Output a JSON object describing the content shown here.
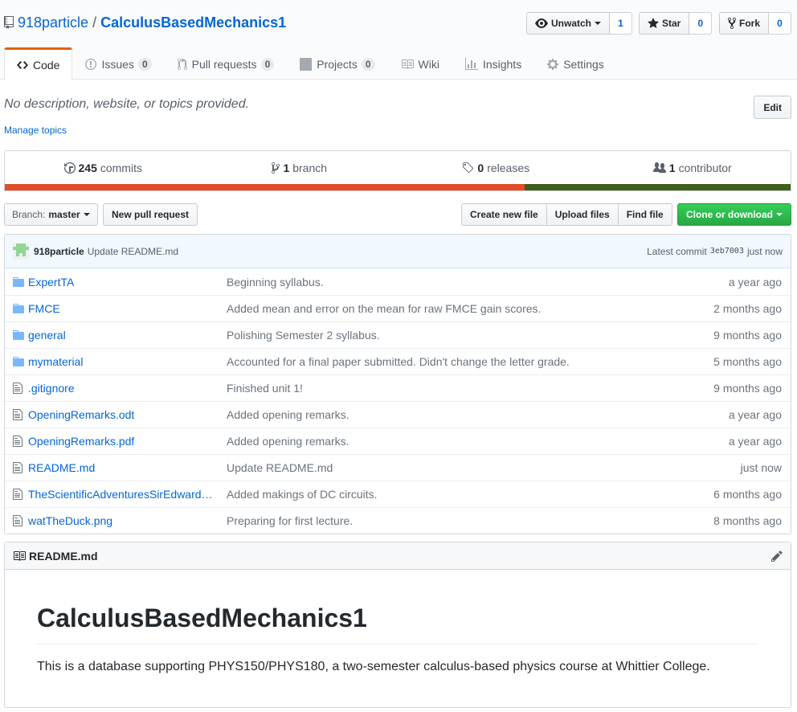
{
  "header": {
    "owner": "918particle",
    "separator": "/",
    "repo": "CalculusBasedMechanics1",
    "watch": {
      "label": "Unwatch",
      "count": "1"
    },
    "star": {
      "label": "Star",
      "count": "0"
    },
    "fork": {
      "label": "Fork",
      "count": "0"
    }
  },
  "tabs": [
    {
      "label": "Code",
      "icon": "code-icon",
      "selected": true
    },
    {
      "label": "Issues",
      "icon": "issue-icon",
      "count": "0"
    },
    {
      "label": "Pull requests",
      "icon": "pull-request-icon",
      "count": "0"
    },
    {
      "label": "Projects",
      "icon": "project-icon",
      "count": "0"
    },
    {
      "label": "Wiki",
      "icon": "book-icon"
    },
    {
      "label": "Insights",
      "icon": "graph-icon"
    },
    {
      "label": "Settings",
      "icon": "gear-icon"
    }
  ],
  "description": {
    "text": "No description, website, or topics provided.",
    "manage_topics": "Manage topics",
    "edit_label": "Edit"
  },
  "summary": {
    "commits": {
      "count": "245",
      "label": "commits"
    },
    "branches": {
      "count": "1",
      "label": "branch"
    },
    "releases": {
      "count": "0",
      "label": "releases"
    },
    "contributors": {
      "count": "1",
      "label": "contributor"
    },
    "languages": [
      {
        "color": "#e34c26",
        "percent": 66.2
      },
      {
        "color": "#3e5f1c",
        "percent": 33.8
      }
    ]
  },
  "nav": {
    "branch_label": "Branch:",
    "branch_name": "master",
    "new_pr": "New pull request",
    "create_file": "Create new file",
    "upload_files": "Upload files",
    "find_file": "Find file",
    "clone": "Clone or download"
  },
  "commit": {
    "author": "918particle",
    "message": "Update README.md",
    "latest_label": "Latest commit",
    "sha": "3eb7003",
    "time": "just now"
  },
  "files": [
    {
      "name": "ExpertTA",
      "type": "dir",
      "message": "Beginning syllabus.",
      "age": "a year ago"
    },
    {
      "name": "FMCE",
      "type": "dir",
      "message": "Added mean and error on the mean for raw FMCE gain scores.",
      "age": "2 months ago"
    },
    {
      "name": "general",
      "type": "dir",
      "message": "Polishing Semester 2 syllabus.",
      "age": "9 months ago"
    },
    {
      "name": "mymaterial",
      "type": "dir",
      "message": "Accounted for a final paper submitted. Didn't change the letter grade.",
      "age": "5 months ago"
    },
    {
      "name": ".gitignore",
      "type": "file",
      "message": "Finished unit 1!",
      "age": "9 months ago"
    },
    {
      "name": "OpeningRemarks.odt",
      "type": "file",
      "message": "Added opening remarks.",
      "age": "a year ago"
    },
    {
      "name": "OpeningRemarks.pdf",
      "type": "file",
      "message": "Added opening remarks.",
      "age": "a year ago"
    },
    {
      "name": "README.md",
      "type": "file",
      "message": "Update README.md",
      "age": "just now"
    },
    {
      "name": "TheScientificAdventuresSirEdward…",
      "type": "file",
      "message": "Added makings of DC circuits.",
      "age": "6 months ago"
    },
    {
      "name": "watTheDuck.png",
      "type": "file",
      "message": "Preparing for first lecture.",
      "age": "8 months ago"
    }
  ],
  "readme": {
    "filename": "README.md",
    "heading": "CalculusBasedMechanics1",
    "body": "This is a database supporting PHYS150/PHYS180, a two-semester calculus-based physics course at Whittier College."
  },
  "colors": {
    "link": "#0366d6",
    "tab_accent": "#e36209",
    "clone_green": "#28a745",
    "folder": "#79b8ff"
  }
}
